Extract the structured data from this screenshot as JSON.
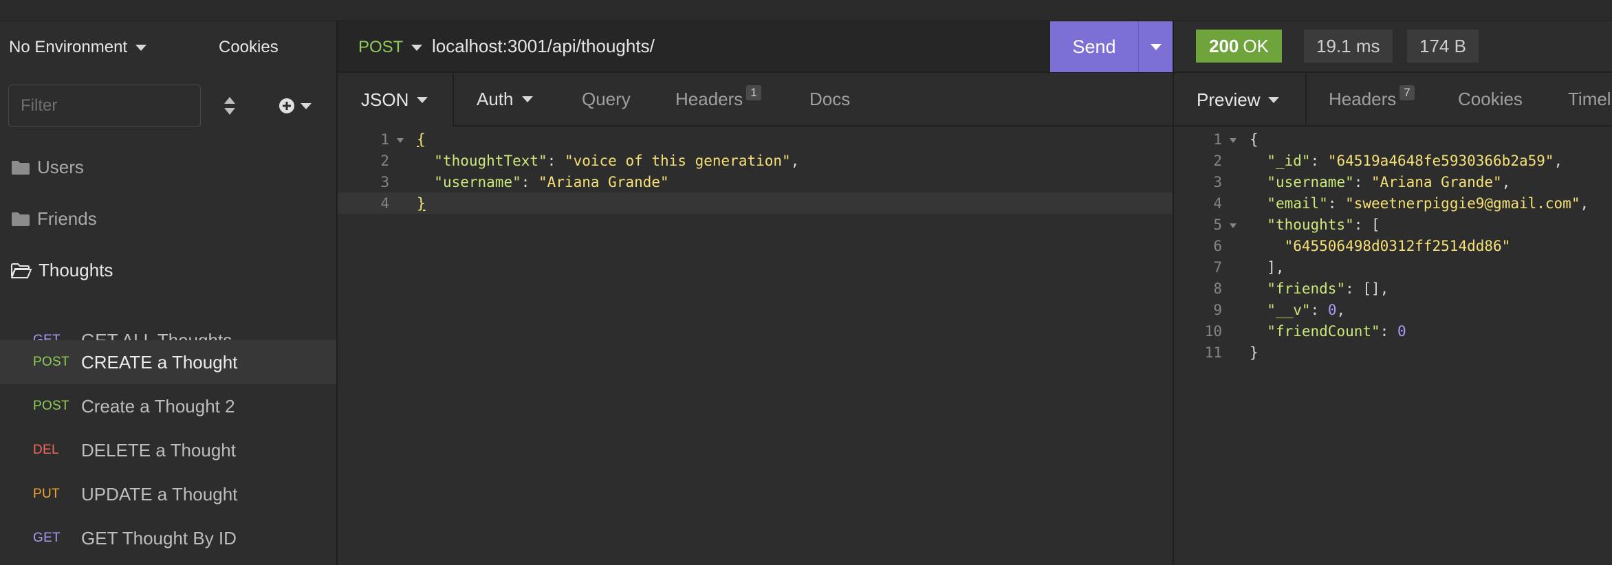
{
  "sidebar": {
    "environment": "No Environment",
    "cookies": "Cookies",
    "filter_placeholder": "Filter",
    "folders": [
      {
        "name": "Users"
      },
      {
        "name": "Friends"
      },
      {
        "name": "Thoughts"
      }
    ],
    "requests": [
      {
        "method": "GET",
        "name": "GET ALL Thoughts"
      },
      {
        "method": "POST",
        "name": "CREATE a Thought"
      },
      {
        "method": "POST",
        "name": "Create a Thought 2"
      },
      {
        "method": "DEL",
        "name": "DELETE a Thought"
      },
      {
        "method": "PUT",
        "name": "UPDATE a Thought"
      },
      {
        "method": "GET",
        "name": "GET Thought By ID"
      }
    ]
  },
  "request": {
    "method": "POST",
    "url": "localhost:3001/api/thoughts/",
    "send_label": "Send",
    "tabs": {
      "body": "JSON",
      "auth": "Auth",
      "query": "Query",
      "headers": "Headers",
      "headers_count": "1",
      "docs": "Docs"
    },
    "body_lines": [
      {
        "num": "1",
        "open": "{"
      },
      {
        "num": "2",
        "key": "\"thoughtText\"",
        "colon": ": ",
        "value": "\"voice of this generation\"",
        "tail": ","
      },
      {
        "num": "3",
        "key": "\"username\"",
        "colon": ": ",
        "value": "\"Ariana Grande\"",
        "tail": ""
      },
      {
        "num": "4",
        "close": "}"
      }
    ]
  },
  "response": {
    "status_code": "200",
    "status_text": "OK",
    "time": "19.1 ms",
    "size": "174 B",
    "tabs": {
      "preview": "Preview",
      "headers": "Headers",
      "headers_count": "7",
      "cookies": "Cookies",
      "timeline": "Timeline"
    },
    "body_lines": [
      {
        "num": "1",
        "text": "{"
      },
      {
        "num": "2",
        "key": "\"_id\"",
        "value": "\"64519a4648fe5930366b2a59\"",
        "tail": ","
      },
      {
        "num": "3",
        "key": "\"username\"",
        "value": "\"Ariana Grande\"",
        "tail": ","
      },
      {
        "num": "4",
        "key": "\"email\"",
        "value": "\"sweetnerpiggie9@gmail.com\"",
        "tail": ","
      },
      {
        "num": "5",
        "key": "\"thoughts\"",
        "value": "[",
        "tail": ""
      },
      {
        "num": "6",
        "item": "\"645506498d0312ff2514dd86\""
      },
      {
        "num": "7",
        "text": "  ],"
      },
      {
        "num": "8",
        "key": "\"friends\"",
        "value": "[]",
        "tail": ","
      },
      {
        "num": "9",
        "key": "\"__v\"",
        "value": "0",
        "tail": ","
      },
      {
        "num": "10",
        "key": "\"friendCount\"",
        "value": "0",
        "tail": ""
      },
      {
        "num": "11",
        "text": "}"
      }
    ]
  },
  "colors": {
    "accent": "#7c6fd6",
    "status_ok": "#6fa33b",
    "get": "#a99cf0",
    "post": "#8fcc58",
    "delete": "#f0695c",
    "put": "#f2a23a"
  }
}
